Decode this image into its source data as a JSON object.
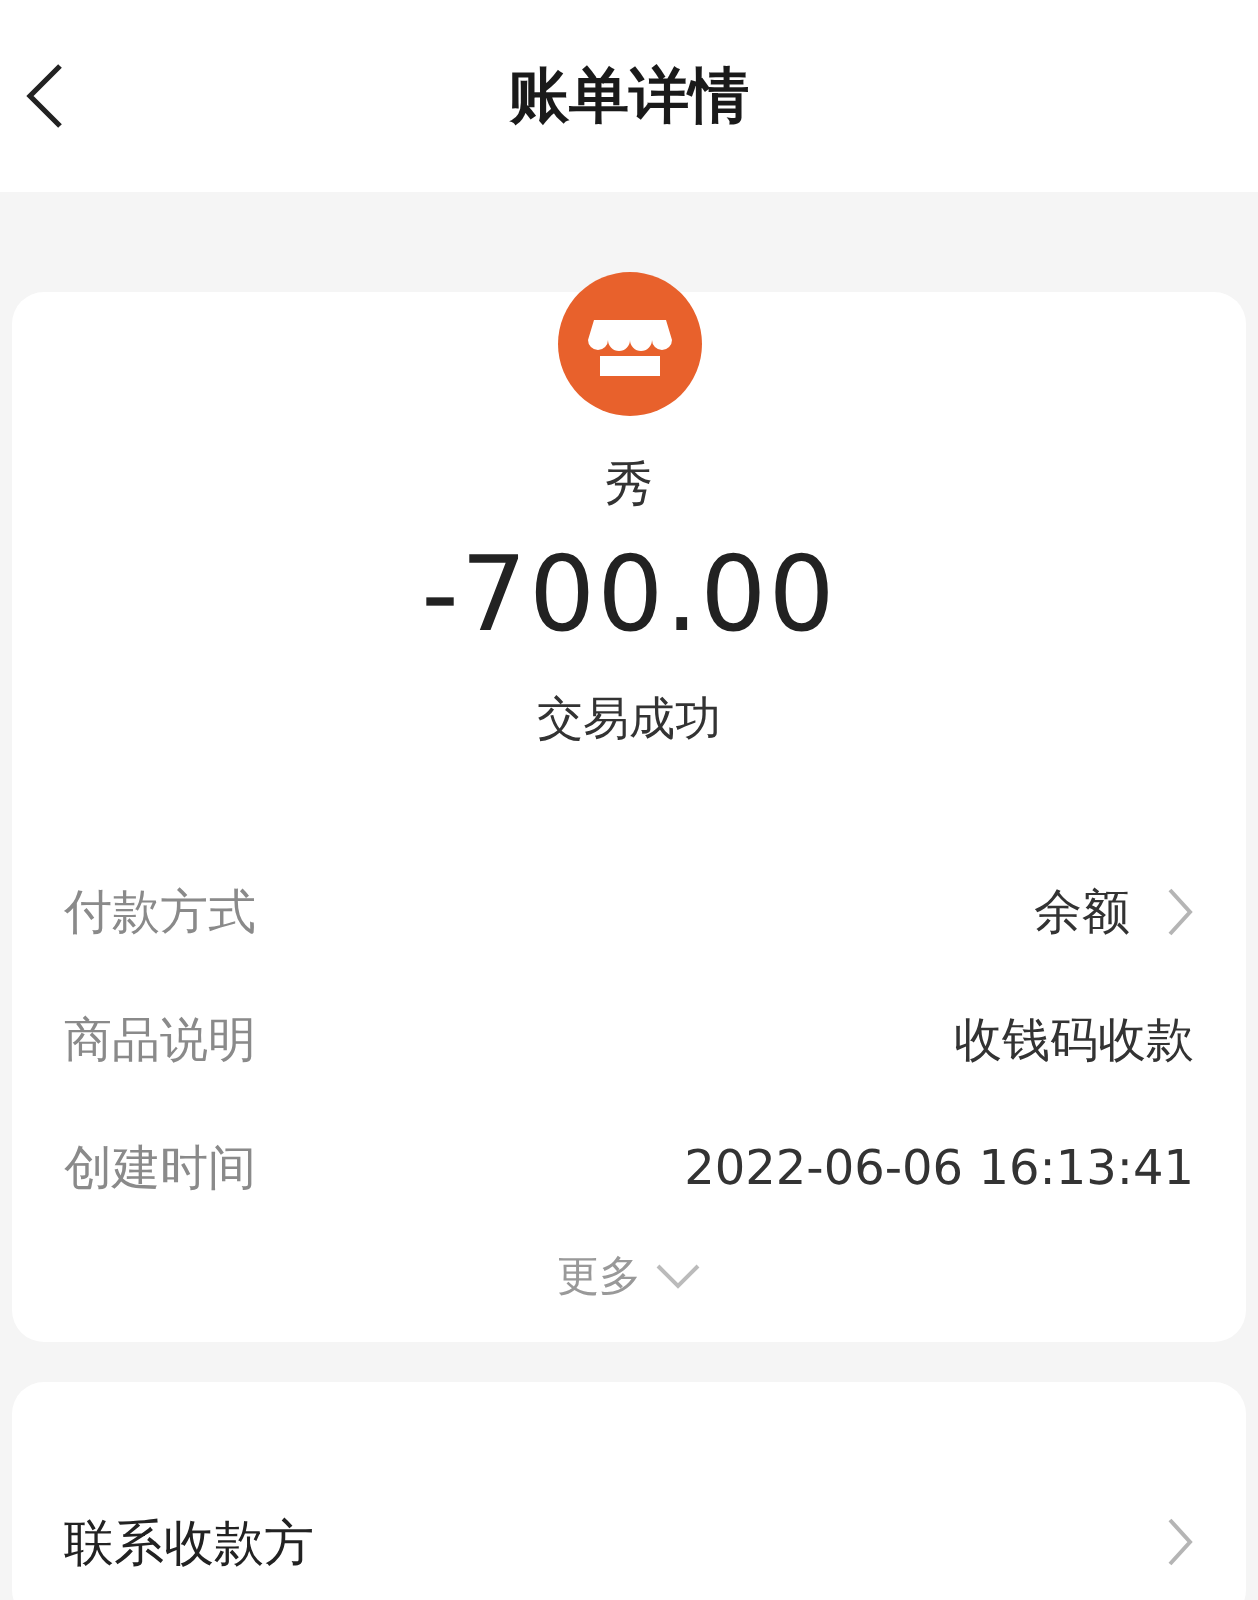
{
  "header": {
    "title": "账单详情"
  },
  "summary": {
    "merchant": "秀",
    "amount": "-700.00",
    "status": "交易成功"
  },
  "details": [
    {
      "label": "付款方式",
      "value": "余额",
      "link": true
    },
    {
      "label": "商品说明",
      "value": "收钱码收款",
      "link": false
    },
    {
      "label": "创建时间",
      "value": "2022-06-06 16:13:41",
      "link": false
    }
  ],
  "more": "更多",
  "contact": {
    "label": "联系收款方"
  }
}
